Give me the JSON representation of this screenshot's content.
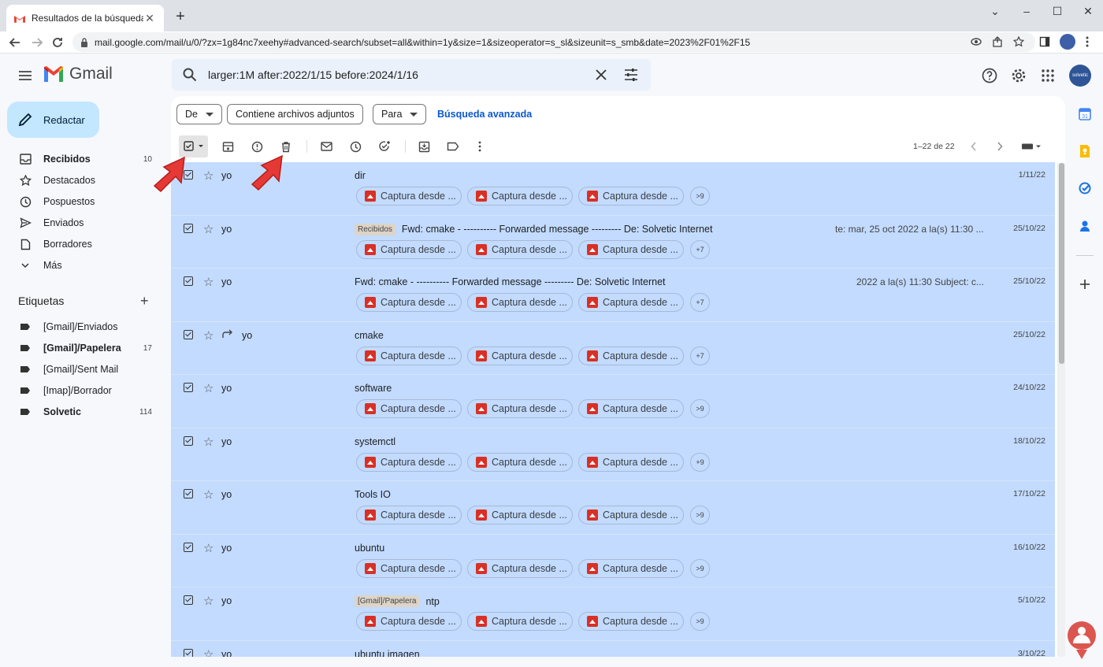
{
  "browser": {
    "tab_title": "Resultados de la búsqueda - solvetic",
    "tab_close": "✕",
    "new_tab": "+",
    "url": "mail.google.com/mail/u/0/?zx=1g84nc7xeehy#advanced-search/subset=all&within=1y&size=1&sizeoperator=s_sl&sizeunit=s_smb&date=2023%2F01%2F15",
    "win_minimize": "⌄",
    "win_restore": "–",
    "win_maximize": "☐",
    "win_close": "✕"
  },
  "header": {
    "logo_text": "Gmail",
    "search_query": "larger:1M after:2022/1/15 before:2024/1/16",
    "avatar_text": "solvetic"
  },
  "sidebar": {
    "compose_label": "Redactar",
    "items": [
      {
        "label": "Recibidos",
        "count": "10",
        "icon": "inbox-icon",
        "bold": true
      },
      {
        "label": "Destacados",
        "count": "",
        "icon": "star-icon",
        "bold": false
      },
      {
        "label": "Pospuestos",
        "count": "",
        "icon": "clock-icon",
        "bold": false
      },
      {
        "label": "Enviados",
        "count": "",
        "icon": "send-icon",
        "bold": false
      },
      {
        "label": "Borradores",
        "count": "",
        "icon": "draft-icon",
        "bold": false
      },
      {
        "label": "Más",
        "count": "",
        "icon": "chevron-down-icon",
        "bold": false
      }
    ],
    "labels_title": "Etiquetas",
    "labels_add": "+",
    "labels": [
      {
        "label": "[Gmail]/Enviados",
        "count": "",
        "bold": false
      },
      {
        "label": "[Gmail]/Papelera",
        "count": "17",
        "bold": true
      },
      {
        "label": "[Gmail]/Sent Mail",
        "count": "",
        "bold": false
      },
      {
        "label": "[Imap]/Borrador",
        "count": "",
        "bold": false
      },
      {
        "label": "Solvetic",
        "count": "114",
        "bold": true
      }
    ]
  },
  "filters": {
    "from": "De",
    "has_attachment": "Contiene archivos adjuntos",
    "to": "Para",
    "advanced": "Búsqueda avanzada"
  },
  "toolbar": {
    "pager": "1–22 de 22"
  },
  "attachment_label": "Captura desde ...",
  "emails": [
    {
      "sender": "yo",
      "subject": "dir",
      "badge": "",
      "tail": "",
      "date": "1/11/22",
      "more": ">9",
      "forwarded": false
    },
    {
      "sender": "yo",
      "subject": "Fwd: cmake - ---------- Forwarded message --------- De: Solvetic Internet",
      "badge": "Recibidos",
      "tail": "te: mar, 25 oct 2022 a la(s) 11:30 ...",
      "date": "25/10/22",
      "more": "+7",
      "forwarded": false
    },
    {
      "sender": "yo",
      "subject": "Fwd: cmake - ---------- Forwarded message --------- De: Solvetic Internet",
      "badge": "",
      "tail": "2022 a la(s) 11:30 Subject: c...",
      "date": "25/10/22",
      "more": "+7",
      "forwarded": false
    },
    {
      "sender": "yo",
      "subject": "cmake",
      "badge": "",
      "tail": "",
      "date": "25/10/22",
      "more": "+7",
      "forwarded": true
    },
    {
      "sender": "yo",
      "subject": "software",
      "badge": "",
      "tail": "",
      "date": "24/10/22",
      "more": ">9",
      "forwarded": false
    },
    {
      "sender": "yo",
      "subject": "systemctl",
      "badge": "",
      "tail": "",
      "date": "18/10/22",
      "more": "+9",
      "forwarded": false
    },
    {
      "sender": "yo",
      "subject": "Tools IO",
      "badge": "",
      "tail": "",
      "date": "17/10/22",
      "more": ">9",
      "forwarded": false
    },
    {
      "sender": "yo",
      "subject": "ubuntu",
      "badge": "",
      "tail": "",
      "date": "16/10/22",
      "more": ">9",
      "forwarded": false
    },
    {
      "sender": "yo",
      "subject": "ntp",
      "badge": "[Gmail]/Papelera",
      "tail": "",
      "date": "5/10/22",
      "more": ">9",
      "forwarded": false
    },
    {
      "sender": "yo",
      "subject": "ubuntu imagen",
      "badge": "",
      "tail": "",
      "date": "3/10/22",
      "more": "",
      "forwarded": false
    }
  ],
  "colors": {
    "selected_row": "#c2dbff",
    "compose_bg": "#c2e7ff",
    "accent": "#0b57d0",
    "arrow": "#e53935"
  }
}
